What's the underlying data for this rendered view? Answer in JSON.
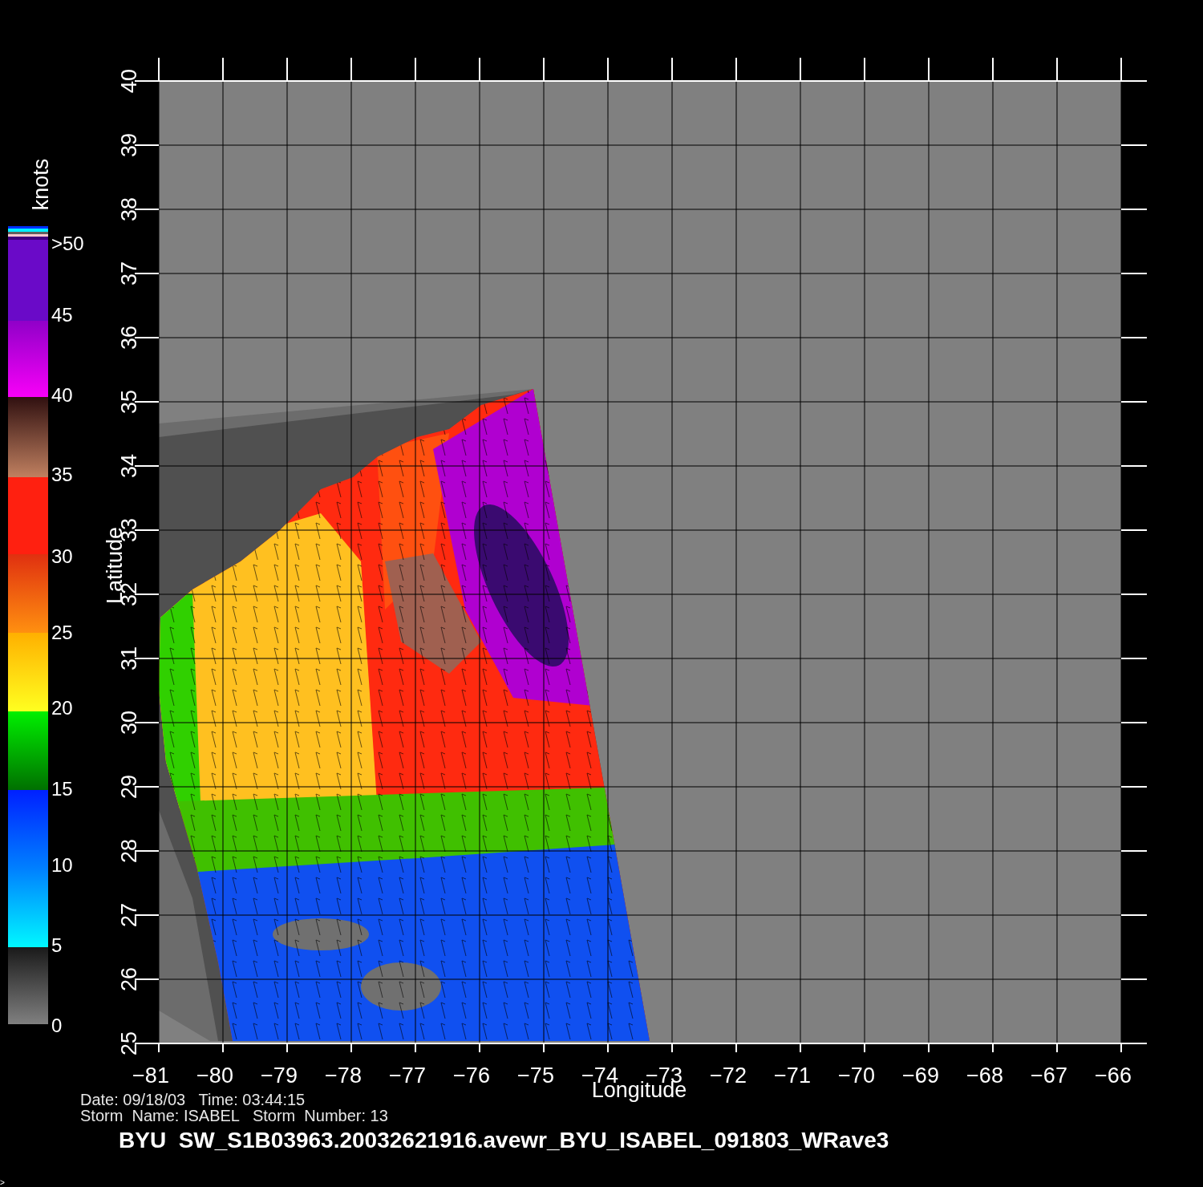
{
  "colorbar": {
    "unit": "knots",
    "labels": [
      ">50",
      "45",
      "40",
      "35",
      "30",
      "25",
      "20",
      "15",
      "10",
      "5",
      "0"
    ]
  },
  "map": {
    "ylabel": "Latitude",
    "xlabel": "Longitude",
    "yticks": [
      "25",
      "26",
      "27",
      "28",
      "29",
      "30",
      "31",
      "32",
      "33",
      "34",
      "35",
      "36",
      "37",
      "38",
      "39",
      "40"
    ],
    "xticks": [
      "−81",
      "−80",
      "−79",
      "−78",
      "−77",
      "−76",
      "−75",
      "−74",
      "−73",
      "−72",
      "−71",
      "−70",
      "−69",
      "−68",
      "−67",
      "−66"
    ]
  },
  "info": [
    "Date: 09/18/03   Time: 03:44:15",
    "Storm  Name: ISABEL   Storm  Number: 13"
  ],
  "title": "BYU  SW_S1B03963.20032621916.avewr_BYU_ISABEL_091803_WRave3",
  "prompt": ">"
}
